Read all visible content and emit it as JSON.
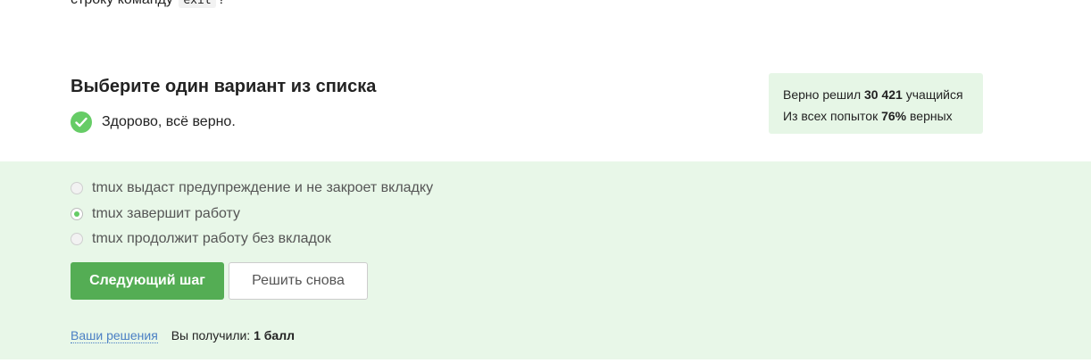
{
  "question_tail": {
    "prefix": "строку команду",
    "code": "exit",
    "suffix": "?"
  },
  "heading": "Выберите один вариант из списка",
  "feedback": {
    "message": "Здорово, всё верно."
  },
  "stats": {
    "line1_prefix": "Верно решил",
    "line1_count": "30 421",
    "line1_suffix": "учащийся",
    "line2_prefix": "Из всех попыток",
    "line2_percent": "76%",
    "line2_suffix": "верных"
  },
  "options": [
    {
      "label": "tmux выдаст предупреждение и не закроет вкладку",
      "selected": false
    },
    {
      "label": "tmux завершит работу",
      "selected": true
    },
    {
      "label": "tmux продолжит работу без вкладок",
      "selected": false
    }
  ],
  "buttons": {
    "next": "Следующий шаг",
    "retry": "Решить снова"
  },
  "footer": {
    "link": "Ваши решения",
    "score_prefix": "Вы получили:",
    "score_value": "1 балл"
  },
  "colors": {
    "accent_green": "#54ad54",
    "answer_bg": "#e8f7e8",
    "stats_bg": "#e6f6e6",
    "link": "#4a7fc4"
  }
}
